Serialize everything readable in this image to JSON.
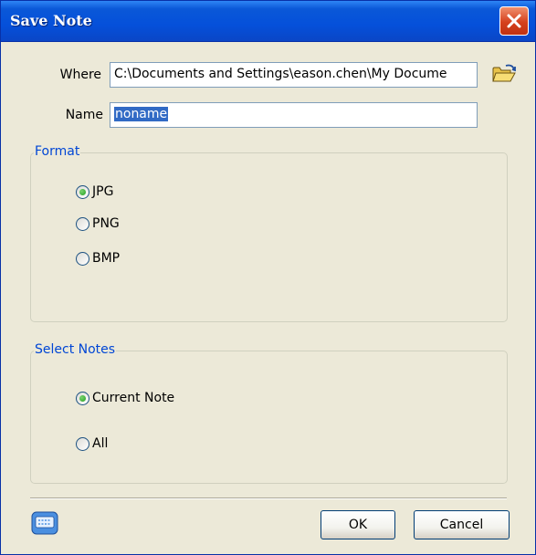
{
  "window": {
    "title": "Save Note"
  },
  "where": {
    "label": "Where",
    "value": "C:\\Documents and Settings\\eason.chen\\My Docume"
  },
  "name": {
    "label": "Name",
    "value": "noname"
  },
  "format": {
    "title": "Format",
    "options": [
      {
        "label": "JPG",
        "selected": true
      },
      {
        "label": "PNG",
        "selected": false
      },
      {
        "label": "BMP",
        "selected": false
      }
    ]
  },
  "select_notes": {
    "title": "Select Notes",
    "options": [
      {
        "label": "Current Note",
        "selected": true
      },
      {
        "label": "All",
        "selected": false
      }
    ]
  },
  "buttons": {
    "ok": "OK",
    "cancel": "Cancel"
  },
  "icons": {
    "browse": "open-folder-icon",
    "keyboard": "keyboard-icon",
    "close": "close-icon"
  }
}
